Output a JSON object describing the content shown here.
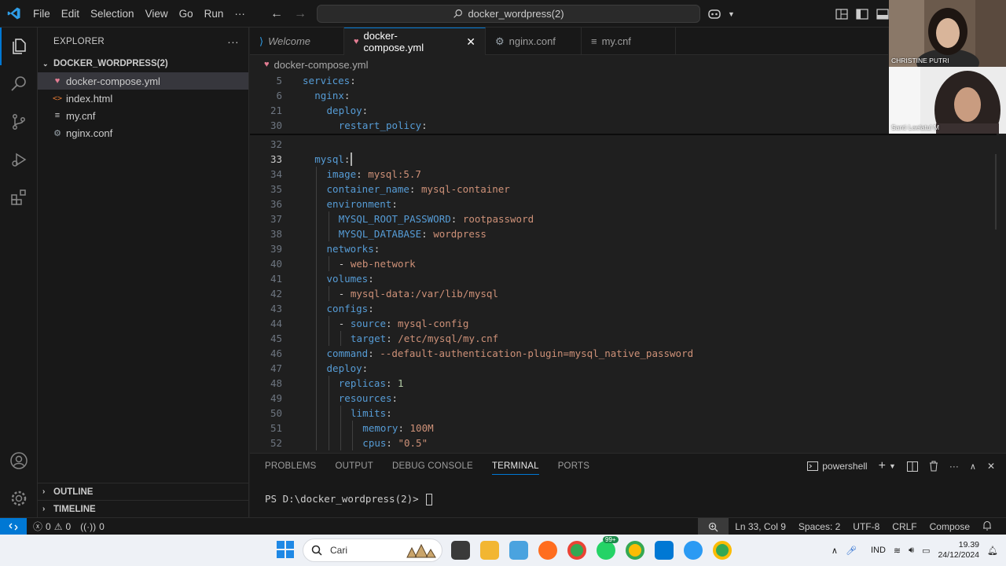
{
  "titlebar": {
    "menu": [
      "File",
      "Edit",
      "Selection",
      "View",
      "Go",
      "Run",
      "···"
    ],
    "search_text": "docker_wordpress(2)"
  },
  "sidebar": {
    "title": "EXPLORER",
    "more": "···",
    "folder": "DOCKER_WORDPRESS(2)",
    "files": [
      {
        "name": "docker-compose.yml",
        "icon": "docker-icon"
      },
      {
        "name": "index.html",
        "icon": "html-icon"
      },
      {
        "name": "my.cnf",
        "icon": "lines-icon"
      },
      {
        "name": "nginx.conf",
        "icon": "gear-icon"
      }
    ],
    "outline": "OUTLINE",
    "timeline": "TIMELINE"
  },
  "tabs": [
    {
      "label": "Welcome",
      "icon": "vscode-icon"
    },
    {
      "label": "docker-compose.yml",
      "icon": "docker-icon",
      "active": true
    },
    {
      "label": "nginx.conf",
      "icon": "gear-icon"
    },
    {
      "label": "my.cnf",
      "icon": "lines-icon"
    }
  ],
  "breadcrumb": "docker-compose.yml",
  "editor": {
    "sticky": [
      {
        "n": "5",
        "code": [
          {
            "t": "services",
            "c": "k"
          },
          {
            "t": ":",
            "c": "p"
          }
        ],
        "indent": 0
      },
      {
        "n": "6",
        "code": [
          {
            "t": "nginx",
            "c": "k"
          },
          {
            "t": ":",
            "c": "p"
          }
        ],
        "indent": 1
      },
      {
        "n": "21",
        "code": [
          {
            "t": "deploy",
            "c": "k"
          },
          {
            "t": ":",
            "c": "p"
          }
        ],
        "indent": 2
      },
      {
        "n": "30",
        "code": [
          {
            "t": "restart_policy",
            "c": "k"
          },
          {
            "t": ":",
            "c": "p"
          }
        ],
        "indent": 3
      }
    ],
    "lines": [
      {
        "n": "32",
        "code": [],
        "indent": 0
      },
      {
        "n": "33",
        "code": [
          {
            "t": "mysql",
            "c": "k"
          },
          {
            "t": ":",
            "c": "p"
          }
        ],
        "indent": 1,
        "current": true
      },
      {
        "n": "34",
        "code": [
          {
            "t": "image",
            "c": "k"
          },
          {
            "t": ": ",
            "c": "p"
          },
          {
            "t": "mysql:5.7",
            "c": "s"
          }
        ],
        "indent": 2
      },
      {
        "n": "35",
        "code": [
          {
            "t": "container_name",
            "c": "k"
          },
          {
            "t": ": ",
            "c": "p"
          },
          {
            "t": "mysql-container",
            "c": "s"
          }
        ],
        "indent": 2
      },
      {
        "n": "36",
        "code": [
          {
            "t": "environment",
            "c": "k"
          },
          {
            "t": ":",
            "c": "p"
          }
        ],
        "indent": 2
      },
      {
        "n": "37",
        "code": [
          {
            "t": "MYSQL_ROOT_PASSWORD",
            "c": "k"
          },
          {
            "t": ": ",
            "c": "p"
          },
          {
            "t": "rootpassword",
            "c": "s"
          }
        ],
        "indent": 3
      },
      {
        "n": "38",
        "code": [
          {
            "t": "MYSQL_DATABASE",
            "c": "k"
          },
          {
            "t": ": ",
            "c": "p"
          },
          {
            "t": "wordpress",
            "c": "s"
          }
        ],
        "indent": 3
      },
      {
        "n": "39",
        "code": [
          {
            "t": "networks",
            "c": "k"
          },
          {
            "t": ":",
            "c": "p"
          }
        ],
        "indent": 2
      },
      {
        "n": "40",
        "code": [
          {
            "t": "- ",
            "c": "p"
          },
          {
            "t": "web-network",
            "c": "s"
          }
        ],
        "indent": 3
      },
      {
        "n": "41",
        "code": [
          {
            "t": "volumes",
            "c": "k"
          },
          {
            "t": ":",
            "c": "p"
          }
        ],
        "indent": 2
      },
      {
        "n": "42",
        "code": [
          {
            "t": "- ",
            "c": "p"
          },
          {
            "t": "mysql-data:/var/lib/mysql",
            "c": "s"
          }
        ],
        "indent": 3
      },
      {
        "n": "43",
        "code": [
          {
            "t": "configs",
            "c": "k"
          },
          {
            "t": ":",
            "c": "p"
          }
        ],
        "indent": 2
      },
      {
        "n": "44",
        "code": [
          {
            "t": "- ",
            "c": "p"
          },
          {
            "t": "source",
            "c": "k"
          },
          {
            "t": ": ",
            "c": "p"
          },
          {
            "t": "mysql-config",
            "c": "s"
          }
        ],
        "indent": 3
      },
      {
        "n": "45",
        "code": [
          {
            "t": "target",
            "c": "k"
          },
          {
            "t": ": ",
            "c": "p"
          },
          {
            "t": "/etc/mysql/my.cnf",
            "c": "s"
          }
        ],
        "indent": 4
      },
      {
        "n": "46",
        "code": [
          {
            "t": "command",
            "c": "k"
          },
          {
            "t": ": ",
            "c": "p"
          },
          {
            "t": "--default-authentication-plugin=mysql_native_password",
            "c": "s"
          }
        ],
        "indent": 2
      },
      {
        "n": "47",
        "code": [
          {
            "t": "deploy",
            "c": "k"
          },
          {
            "t": ":",
            "c": "p"
          }
        ],
        "indent": 2
      },
      {
        "n": "48",
        "code": [
          {
            "t": "replicas",
            "c": "k"
          },
          {
            "t": ": ",
            "c": "p"
          },
          {
            "t": "1",
            "c": "n"
          }
        ],
        "indent": 3
      },
      {
        "n": "49",
        "code": [
          {
            "t": "resources",
            "c": "k"
          },
          {
            "t": ":",
            "c": "p"
          }
        ],
        "indent": 3
      },
      {
        "n": "50",
        "code": [
          {
            "t": "limits",
            "c": "k"
          },
          {
            "t": ":",
            "c": "p"
          }
        ],
        "indent": 4
      },
      {
        "n": "51",
        "code": [
          {
            "t": "memory",
            "c": "k"
          },
          {
            "t": ": ",
            "c": "p"
          },
          {
            "t": "100M",
            "c": "s"
          }
        ],
        "indent": 5
      },
      {
        "n": "52",
        "code": [
          {
            "t": "cpus",
            "c": "k"
          },
          {
            "t": ": ",
            "c": "p"
          },
          {
            "t": "\"0.5\"",
            "c": "s"
          }
        ],
        "indent": 5
      }
    ]
  },
  "panel": {
    "tabs": [
      "PROBLEMS",
      "OUTPUT",
      "DEBUG CONSOLE",
      "TERMINAL",
      "PORTS"
    ],
    "active_tab": "TERMINAL",
    "shell": "powershell",
    "prompt": "PS D:\\docker_wordpress(2)> "
  },
  "statusbar": {
    "errors": "0",
    "warnings": "0",
    "ports": "0",
    "position": "Ln 33, Col 9",
    "spaces": "Spaces: 2",
    "encoding": "UTF-8",
    "eol": "CRLF",
    "language": "Compose"
  },
  "taskbar": {
    "search_placeholder": "Cari",
    "lang": "IND",
    "time": "19.39",
    "date": "24/12/2024",
    "badge": "99+"
  },
  "video": {
    "participant1": "CHRISTINE PUTRI",
    "participant2": "Santi Laelatul M"
  },
  "colors": {
    "accent": "#0078d4",
    "yaml_key": "#569cd6",
    "yaml_string": "#ce9178",
    "yaml_number": "#b5cea8"
  }
}
